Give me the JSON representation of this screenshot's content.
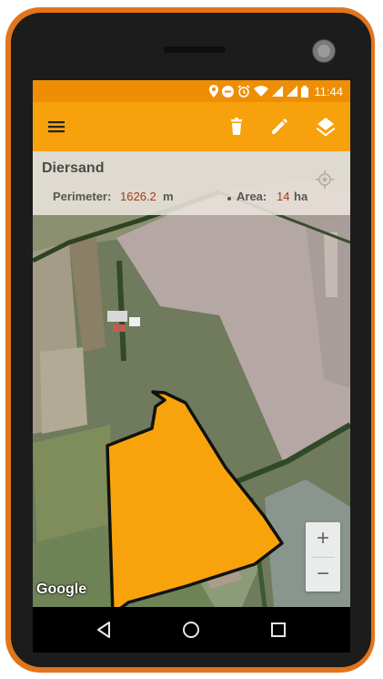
{
  "status_bar": {
    "time": "11:44",
    "icons": [
      "location-icon",
      "do-not-disturb-icon",
      "alarm-icon",
      "wifi-icon",
      "signal-icon",
      "battery-icon"
    ]
  },
  "app_bar": {
    "color": "#f7a10c",
    "actions": [
      "menu-icon",
      "delete-icon",
      "edit-icon",
      "layers-icon"
    ]
  },
  "field": {
    "name": "Diersand",
    "perimeter_label": "Perimeter:",
    "perimeter_value": "1626.2",
    "perimeter_unit": "m",
    "area_label": "Area:",
    "area_value": "14",
    "area_unit": "ha",
    "polygon_color": "#f9a30c"
  },
  "map": {
    "attribution": "Google",
    "zoom_in_label": "+",
    "zoom_out_label": "−"
  },
  "device": {
    "frame_color": "#e2751c",
    "nav_buttons": [
      "back-icon",
      "home-icon",
      "recents-icon"
    ]
  }
}
